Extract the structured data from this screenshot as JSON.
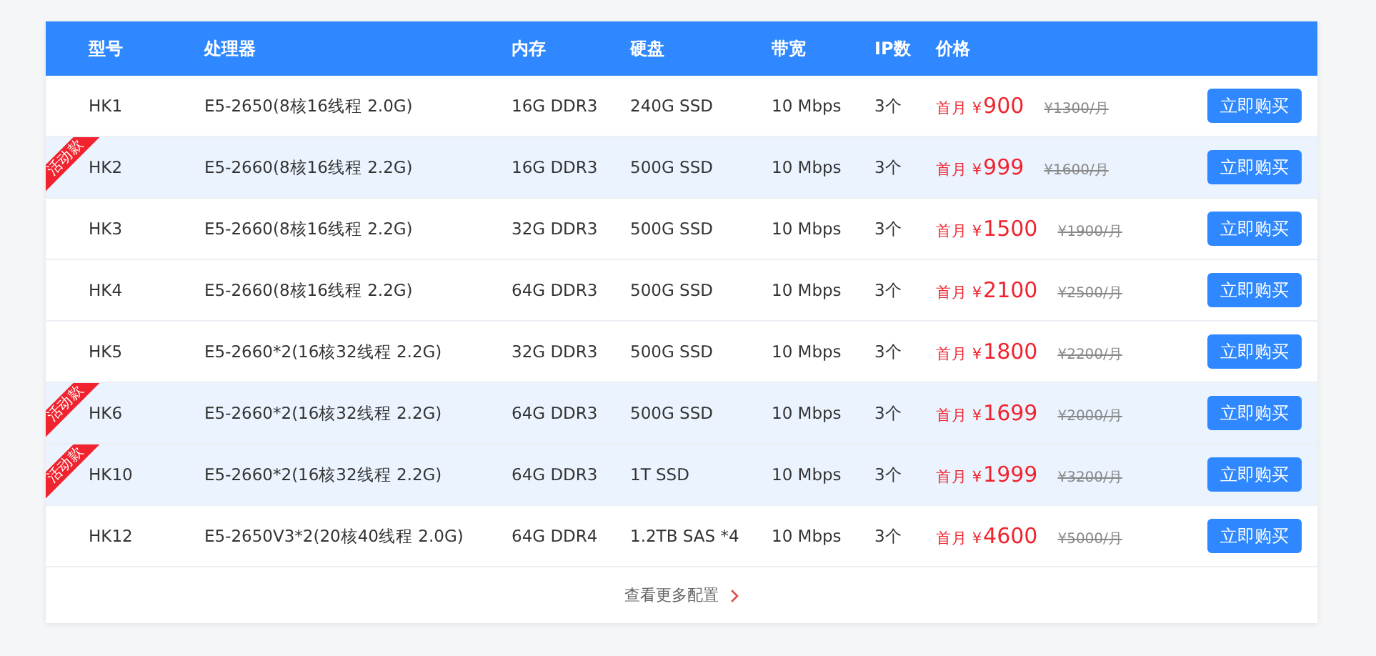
{
  "table": {
    "columns": [
      "型号",
      "处理器",
      "内存",
      "硬盘",
      "带宽",
      "IP数",
      "价格"
    ],
    "rows": [
      {
        "model": "HK1",
        "cpu": "E5-2650(8核16线程 2.0G)",
        "memory": "16G DDR3",
        "disk": "240G SSD",
        "bandwidth": "10 Mbps",
        "ips": "3个",
        "price_prefix": "首月 ¥",
        "price": "900",
        "original_price": "¥1300/月",
        "button": "立即购买",
        "promo": false
      },
      {
        "model": "HK2",
        "cpu": "E5-2660(8核16线程 2.2G)",
        "memory": "16G DDR3",
        "disk": "500G SSD",
        "bandwidth": "10 Mbps",
        "ips": "3个",
        "price_prefix": "首月 ¥",
        "price": "999",
        "original_price": "¥1600/月",
        "button": "立即购买",
        "promo": true,
        "badge": "活动款"
      },
      {
        "model": "HK3",
        "cpu": "E5-2660(8核16线程 2.2G)",
        "memory": "32G DDR3",
        "disk": "500G SSD",
        "bandwidth": "10 Mbps",
        "ips": "3个",
        "price_prefix": "首月 ¥",
        "price": "1500",
        "original_price": "¥1900/月",
        "button": "立即购买",
        "promo": false
      },
      {
        "model": "HK4",
        "cpu": "E5-2660(8核16线程 2.2G)",
        "memory": "64G DDR3",
        "disk": "500G SSD",
        "bandwidth": "10 Mbps",
        "ips": "3个",
        "price_prefix": "首月 ¥",
        "price": "2100",
        "original_price": "¥2500/月",
        "button": "立即购买",
        "promo": false
      },
      {
        "model": "HK5",
        "cpu": "E5-2660*2(16核32线程 2.2G)",
        "memory": "32G DDR3",
        "disk": "500G SSD",
        "bandwidth": "10 Mbps",
        "ips": "3个",
        "price_prefix": "首月 ¥",
        "price": "1800",
        "original_price": "¥2200/月",
        "button": "立即购买",
        "promo": false
      },
      {
        "model": "HK6",
        "cpu": "E5-2660*2(16核32线程 2.2G)",
        "memory": "64G DDR3",
        "disk": "500G SSD",
        "bandwidth": "10 Mbps",
        "ips": "3个",
        "price_prefix": "首月 ¥",
        "price": "1699",
        "original_price": "¥2000/月",
        "button": "立即购买",
        "promo": true,
        "badge": "活动款"
      },
      {
        "model": "HK10",
        "cpu": "E5-2660*2(16核32线程 2.2G)",
        "memory": "64G DDR3",
        "disk": "1T SSD",
        "bandwidth": "10 Mbps",
        "ips": "3个",
        "price_prefix": "首月 ¥",
        "price": "1999",
        "original_price": "¥3200/月",
        "button": "立即购买",
        "promo": true,
        "badge": "活动款"
      },
      {
        "model": "HK12",
        "cpu": "E5-2650V3*2(20核40线程 2.0G)",
        "memory": "64G DDR4",
        "disk": "1.2TB SAS *4",
        "bandwidth": "10 Mbps",
        "ips": "3个",
        "price_prefix": "首月 ¥",
        "price": "4600",
        "original_price": "¥5000/月",
        "button": "立即购买",
        "promo": false
      }
    ]
  },
  "more_link": "查看更多配置"
}
